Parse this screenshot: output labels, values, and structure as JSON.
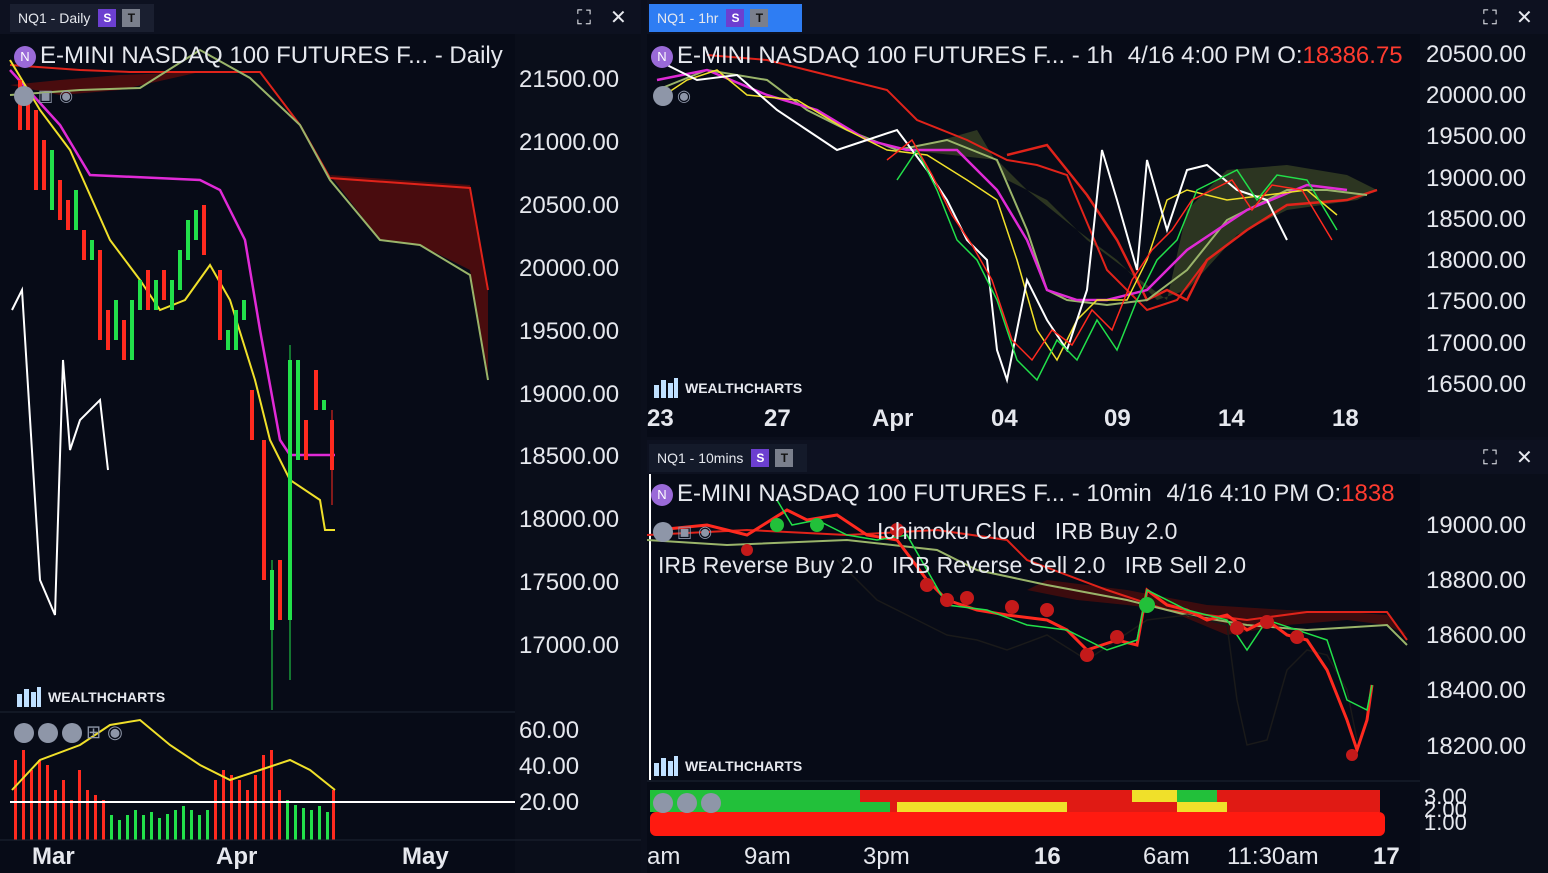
{
  "panel_left": {
    "tab": {
      "label": "NQ1 - Daily",
      "badge_s": "S",
      "badge_t": "T"
    },
    "title": "E-MINI NASDAQ 100 FUTURES F... - Daily",
    "y_ticks": [
      "21500.00",
      "21000.00",
      "20500.00",
      "20000.00",
      "19500.00",
      "19000.00",
      "18500.00",
      "18000.00",
      "17500.00",
      "17000.00"
    ],
    "sub_ticks": [
      "60.00",
      "40.00",
      "20.00"
    ],
    "x_ticks": [
      "Mar",
      "Apr",
      "May"
    ],
    "watermark": "WEALTHCHARTS"
  },
  "panel_top_right": {
    "tab": {
      "label": "NQ1 - 1hr",
      "badge_s": "S",
      "badge_t": "T"
    },
    "title": "E-MINI NASDAQ 100 FUTURES F... - 1h",
    "ohlc_prefix": "4/16 4:00 PM O:",
    "ohlc_open": "18386.75",
    "y_ticks": [
      "20500.00",
      "20000.00",
      "19500.00",
      "19000.00",
      "18500.00",
      "18000.00",
      "17500.00",
      "17000.00",
      "16500.00"
    ],
    "x_ticks": [
      "23",
      "27",
      "Apr",
      "04",
      "09",
      "14",
      "18"
    ],
    "watermark": "WEALTHCHARTS"
  },
  "panel_bottom_right": {
    "tab": {
      "label": "NQ1 - 10mins",
      "badge_s": "S",
      "badge_t": "T"
    },
    "title": "E-MINI NASDAQ 100 FUTURES F... - 10min",
    "ohlc_prefix": "4/16 4:10 PM O:",
    "ohlc_open": "1838",
    "indicator_line1": [
      "Ichimoku Cloud",
      "IRB Buy 2.0"
    ],
    "indicator_line2": [
      "IRB Reverse Buy 2.0",
      "IRB Reverse Sell 2.0",
      "IRB Sell 2.0"
    ],
    "y_ticks": [
      "19000.00",
      "18800.00",
      "18600.00",
      "18400.00",
      "18200.00"
    ],
    "sub_ticks": [
      "3.00",
      "2.00",
      "1.00"
    ],
    "x_ticks": [
      "am",
      "9am",
      "3pm",
      "16",
      "6am",
      "11:30am",
      "17"
    ],
    "watermark": "WEALTHCHARTS"
  },
  "colors": {
    "bull": "#22e04a",
    "bear": "#ff2a1f",
    "tab_active": "#2e7df3",
    "badge_s": "#6c3fd0"
  }
}
